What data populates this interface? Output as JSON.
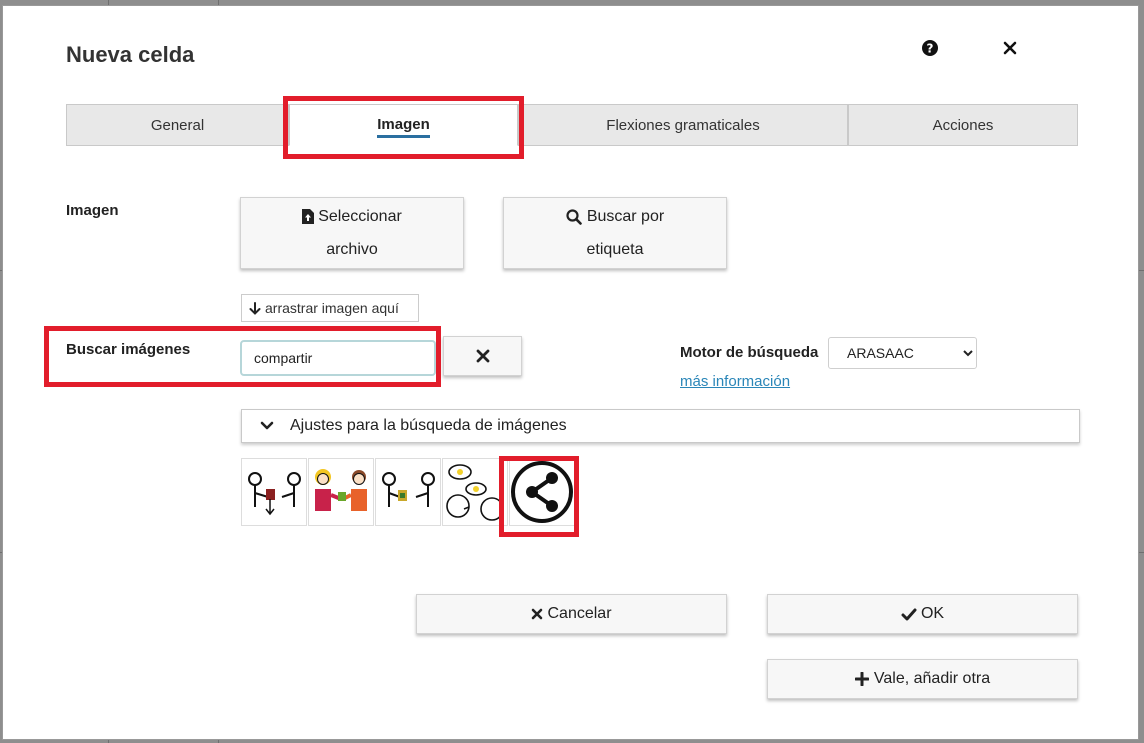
{
  "dialog": {
    "title": "Nueva celda",
    "help_icon": "question-circle-icon",
    "close_icon": "close-icon"
  },
  "tabs": [
    {
      "label": "General",
      "active": false
    },
    {
      "label": "Imagen",
      "active": true
    },
    {
      "label": "Flexiones gramaticales",
      "active": false
    },
    {
      "label": "Acciones",
      "active": false
    }
  ],
  "image_section": {
    "label": "Imagen",
    "select_file_button": {
      "label_line1": "Seleccionar",
      "label_line2": "archivo",
      "icon": "file-upload-icon"
    },
    "search_tag_button": {
      "label_line1": "Buscar por",
      "label_line2": "etiqueta",
      "icon": "search-icon"
    },
    "drop_zone": {
      "label": "arrastrar imagen aquí",
      "icon": "arrow-down-icon"
    }
  },
  "search": {
    "label": "Buscar imágenes",
    "value": "compartir",
    "clear_icon": "times-icon",
    "engine_label": "Motor de búsqueda",
    "engine_value": "ARASAAC",
    "more_info": "más información"
  },
  "settings_toggle": {
    "label": "Ajustes para la búsqueda de imágenes",
    "icon": "chevron-down-icon"
  },
  "results": [
    {
      "name": "give-object-pictogram"
    },
    {
      "name": "share-people-color-pictogram"
    },
    {
      "name": "give-green-object-pictogram"
    },
    {
      "name": "share-ideas-pictogram"
    },
    {
      "name": "share-symbol-pictogram"
    }
  ],
  "footer": {
    "cancel_label": "Cancelar",
    "ok_label": "OK",
    "add_another_label": "Vale, añadir otra"
  },
  "colors": {
    "highlight": "#e21d2b",
    "accent_underline": "#2a6fa0",
    "link": "#2a86b8"
  }
}
